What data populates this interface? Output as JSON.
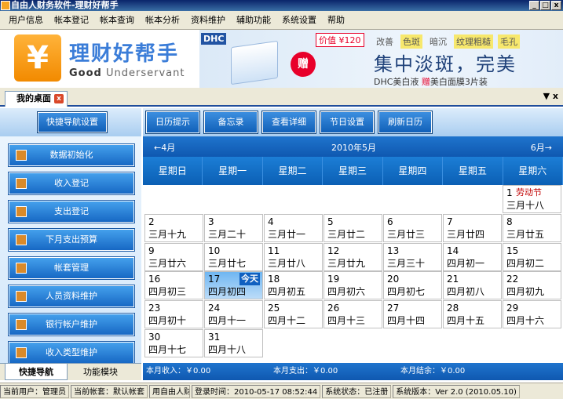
{
  "window": {
    "title": "自由人财务软件-理财好帮手"
  },
  "menu": [
    "用户信息",
    "帐本登记",
    "帐本查询",
    "帐本分析",
    "资料维护",
    "辅助功能",
    "系统设置",
    "帮助"
  ],
  "banner": {
    "logo_text": "理财好帮手",
    "tagline_bold": "Good",
    "tagline": "Underservant",
    "logo_symbol": "¥",
    "ad": {
      "brand": "DHC",
      "gift": "赠",
      "price": "价值 ¥120",
      "tags": [
        "改善",
        "色斑",
        "暗沉",
        "纹理粗糙",
        "毛孔"
      ],
      "headline": "集中淡斑，完美",
      "sub_prefix": "DHC美白液 ",
      "sub_red": "赠",
      "sub_suffix": "美白面膜3片装"
    }
  },
  "tabs": {
    "active": "我的桌面",
    "close": "x",
    "controls": "▼ x"
  },
  "left": {
    "quick_button": "快捷导航设置",
    "nav": [
      "数据初始化",
      "收入登记",
      "支出登记",
      "下月支出预算",
      "帐套管理",
      "人员资料维护",
      "银行帐户维护",
      "收入类型维护"
    ],
    "bottom_tabs": [
      "快捷导航",
      "功能模块"
    ]
  },
  "toolbar": [
    "日历提示",
    "备忘录",
    "查看详细",
    "节日设置",
    "刷新日历"
  ],
  "calendar": {
    "prev": "←4月",
    "title": "2010年5月",
    "next": "6月→",
    "weekdays": [
      "星期日",
      "星期一",
      "星期二",
      "星期三",
      "星期四",
      "星期五",
      "星期六"
    ],
    "today_label": "今天",
    "days": [
      {
        "d": "1",
        "l": "三月十八",
        "h": "劳动节"
      },
      {
        "d": "2",
        "l": "三月十九"
      },
      {
        "d": "3",
        "l": "三月二十"
      },
      {
        "d": "4",
        "l": "三月廿一"
      },
      {
        "d": "5",
        "l": "三月廿二"
      },
      {
        "d": "6",
        "l": "三月廿三"
      },
      {
        "d": "7",
        "l": "三月廿四"
      },
      {
        "d": "8",
        "l": "三月廿五"
      },
      {
        "d": "9",
        "l": "三月廿六"
      },
      {
        "d": "10",
        "l": "三月廿七"
      },
      {
        "d": "11",
        "l": "三月廿八"
      },
      {
        "d": "12",
        "l": "三月廿九"
      },
      {
        "d": "13",
        "l": "三月三十"
      },
      {
        "d": "14",
        "l": "四月初一"
      },
      {
        "d": "15",
        "l": "四月初二"
      },
      {
        "d": "16",
        "l": "四月初三"
      },
      {
        "d": "17",
        "l": "四月初四",
        "today": true
      },
      {
        "d": "18",
        "l": "四月初五"
      },
      {
        "d": "19",
        "l": "四月初六"
      },
      {
        "d": "20",
        "l": "四月初七"
      },
      {
        "d": "21",
        "l": "四月初八"
      },
      {
        "d": "22",
        "l": "四月初九"
      },
      {
        "d": "23",
        "l": "四月初十"
      },
      {
        "d": "24",
        "l": "四月十一"
      },
      {
        "d": "25",
        "l": "四月十二"
      },
      {
        "d": "26",
        "l": "四月十三"
      },
      {
        "d": "27",
        "l": "四月十四"
      },
      {
        "d": "28",
        "l": "四月十五"
      },
      {
        "d": "29",
        "l": "四月十六"
      },
      {
        "d": "30",
        "l": "四月十七"
      },
      {
        "d": "31",
        "l": "四月十八"
      }
    ],
    "first_weekday": 6
  },
  "summary": {
    "income": "本月收入：￥0.00",
    "expense": "本月支出：￥0.00",
    "balance": "本月结余：￥0.00"
  },
  "status": [
    "当前用户：管理员",
    "当前帐套：默认帐套",
    "用自由人财",
    "登录时间：2010-05-17 08:52:44",
    "系统状态：已注册",
    "系统版本：Ver 2.0 (2010.05.10)"
  ],
  "colors": {
    "accent": "#1160b8",
    "holiday": "#c00000",
    "title_bar": "#0a246a"
  }
}
